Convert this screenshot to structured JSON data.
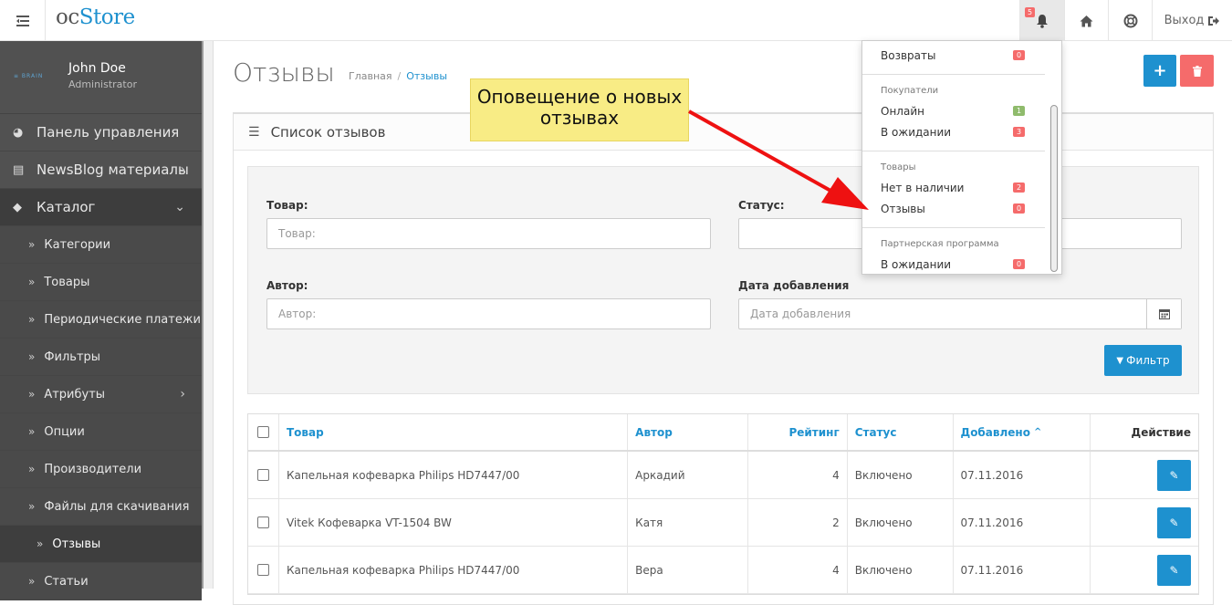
{
  "header": {
    "logo_prefix": "oc",
    "logo_main": "Store",
    "notifications_count": "5",
    "logout_label": "Выход"
  },
  "sidebar": {
    "brand": "≡ BRAIN",
    "user_name": "John Doe",
    "user_role": "Administrator",
    "items": [
      {
        "label": "Панель управления",
        "icon": "dashboard-icon"
      },
      {
        "label": "NewsBlog материалы",
        "icon": "newspaper-icon"
      },
      {
        "label": "Каталог",
        "icon": "tags-icon"
      }
    ],
    "catalog_items": [
      "Категории",
      "Товары",
      "Периодические платежи",
      "Фильтры",
      "Атрибуты",
      "Опции",
      "Производители",
      "Файлы для скачивания",
      "Отзывы",
      "Статьи"
    ]
  },
  "page": {
    "title": "Отзывы",
    "breadcrumb_home": "Главная",
    "breadcrumb_current": "Отзывы",
    "panel_title": "Список отзывов"
  },
  "filter": {
    "product_label": "Товар:",
    "product_placeholder": "Товар:",
    "status_label": "Статус:",
    "author_label": "Автор:",
    "author_placeholder": "Автор:",
    "date_label": "Дата добавления",
    "date_placeholder": "Дата добавления",
    "button_label": "Фильтр"
  },
  "table": {
    "headers": [
      "Товар",
      "Автор",
      "Рейтинг",
      "Статус",
      "Добавлено",
      "Действие"
    ],
    "rows": [
      {
        "product": "Капельная кофеварка Philips HD7447/00",
        "author": "Аркадий",
        "rating": "4",
        "status": "Включено",
        "date": "07.11.2016"
      },
      {
        "product": "Vitek Кофеварка VT-1504 BW",
        "author": "Катя",
        "rating": "2",
        "status": "Включено",
        "date": "07.11.2016"
      },
      {
        "product": "Капельная кофеварка Philips HD7447/00",
        "author": "Вера",
        "rating": "4",
        "status": "Включено",
        "date": "07.11.2016"
      }
    ]
  },
  "notifications": {
    "returns": "Возвраты",
    "returns_count": "0",
    "customers_header": "Покупатели",
    "online": "Онлайн",
    "online_count": "1",
    "pending": "В ожидании",
    "pending_count": "3",
    "products_header": "Товары",
    "out_of_stock": "Нет в наличии",
    "out_of_stock_count": "2",
    "reviews": "Отзывы",
    "reviews_count": "0",
    "affiliate_header": "Партнерская программа",
    "affiliate_pending": "В ожидании",
    "affiliate_pending_count": "0"
  },
  "annotation": {
    "text": "Оповещение о новых отзывах",
    "color": "#f8ec85",
    "arrow_color": "#ee1111"
  },
  "colors": {
    "primary": "#1e91cf",
    "danger": "#f56b6b",
    "success": "#8fbb6c",
    "sidebar": "#515151"
  }
}
